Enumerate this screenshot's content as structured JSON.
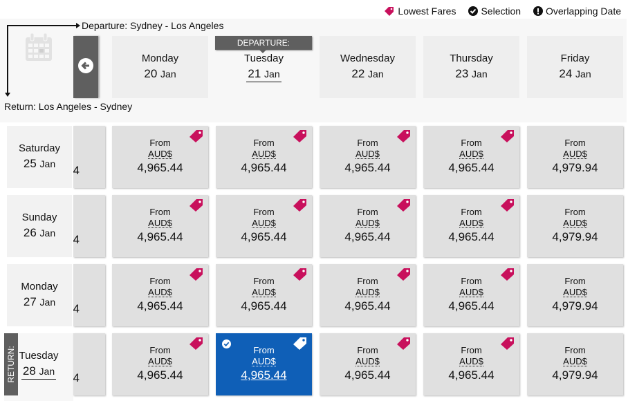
{
  "legend": [
    {
      "label": "Lowest Fares",
      "icon": "tag-icon"
    },
    {
      "label": "Selection",
      "icon": "check-circle-icon"
    },
    {
      "label": "Overlapping Date",
      "icon": "exclamation-circle-icon"
    }
  ],
  "colors": {
    "tag": "#c8105c",
    "selected": "#0f5fb7",
    "tab": "#5f5f5f"
  },
  "departure_label": "Departure: Sydney - Los Angeles",
  "return_label": "Return: Los Angeles - Sydney",
  "departure_tab": "DEPARTURE:",
  "return_tab": "RETURN:",
  "departure_dates": [
    {
      "day": "Monday",
      "num": "20",
      "mon": "Jan"
    },
    {
      "day": "Tuesday",
      "num": "21",
      "mon": "Jan",
      "selected": true
    },
    {
      "day": "Wednesday",
      "num": "22",
      "mon": "Jan"
    },
    {
      "day": "Thursday",
      "num": "23",
      "mon": "Jan"
    },
    {
      "day": "Friday",
      "num": "24",
      "mon": "Jan"
    }
  ],
  "return_dates": [
    {
      "day": "Saturday",
      "num": "25",
      "mon": "Jan"
    },
    {
      "day": "Sunday",
      "num": "26",
      "mon": "Jan"
    },
    {
      "day": "Monday",
      "num": "27",
      "mon": "Jan"
    },
    {
      "day": "Tuesday",
      "num": "28",
      "mon": "Jan",
      "selected": true
    }
  ],
  "cell_from": "From",
  "cell_currency": "AUD$",
  "partial_text": "4",
  "fares": [
    [
      {
        "price": "4,965.44",
        "lowest": true
      },
      {
        "price": "4,965.44",
        "lowest": true
      },
      {
        "price": "4,965.44",
        "lowest": true
      },
      {
        "price": "4,965.44",
        "lowest": true
      },
      {
        "price": "4,979.94",
        "lowest": false
      }
    ],
    [
      {
        "price": "4,965.44",
        "lowest": true
      },
      {
        "price": "4,965.44",
        "lowest": true
      },
      {
        "price": "4,965.44",
        "lowest": true
      },
      {
        "price": "4,965.44",
        "lowest": true
      },
      {
        "price": "4,979.94",
        "lowest": false
      }
    ],
    [
      {
        "price": "4,965.44",
        "lowest": true
      },
      {
        "price": "4,965.44",
        "lowest": true
      },
      {
        "price": "4,965.44",
        "lowest": true
      },
      {
        "price": "4,965.44",
        "lowest": true
      },
      {
        "price": "4,979.94",
        "lowest": false
      }
    ],
    [
      {
        "price": "4,965.44",
        "lowest": true
      },
      {
        "price": "4,965.44",
        "lowest": true,
        "selected": true
      },
      {
        "price": "4,965.44",
        "lowest": true
      },
      {
        "price": "4,965.44",
        "lowest": true
      },
      {
        "price": "4,979.94",
        "lowest": false
      }
    ]
  ]
}
